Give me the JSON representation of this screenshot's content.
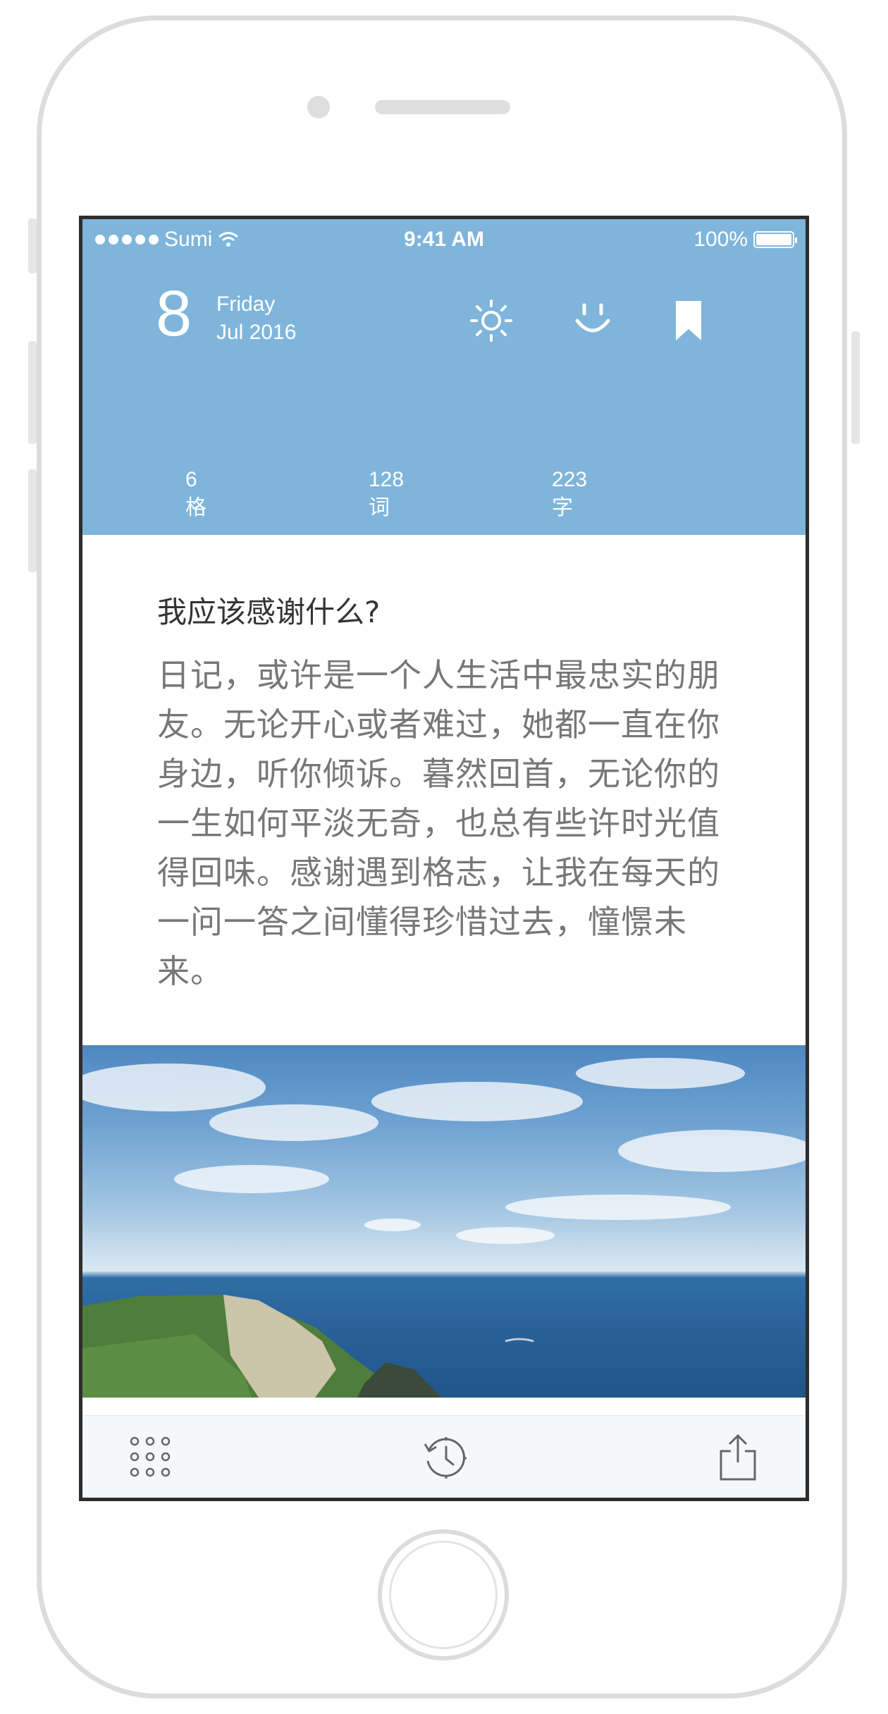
{
  "status_bar": {
    "carrier": "Sumi",
    "time": "9:41 AM",
    "battery": "100%"
  },
  "header": {
    "day": "8",
    "weekday": "Friday",
    "month_year": "Jul 2016",
    "icons": [
      "sun-icon",
      "smile-icon",
      "bookmark-icon"
    ],
    "background": "#7fb5db"
  },
  "stats": [
    {
      "value": "6",
      "label": "格"
    },
    {
      "value": "128",
      "label": "词"
    },
    {
      "value": "223",
      "label": "字"
    }
  ],
  "entry": {
    "question": "我应该感谢什么?",
    "text": "日记，或许是一个人生活中最忠实的朋友。无论开心或者难过，她都一直在你身边，听你倾诉。暮然回首，无论你的一生如何平淡无奇，也总有些许时光值得回味。感谢遇到格志，让我在每天的一问一答之间懂得珍惜过去，憧憬未来。"
  },
  "toolbar": {
    "icons": [
      "grid-icon",
      "history-icon",
      "share-icon"
    ]
  }
}
